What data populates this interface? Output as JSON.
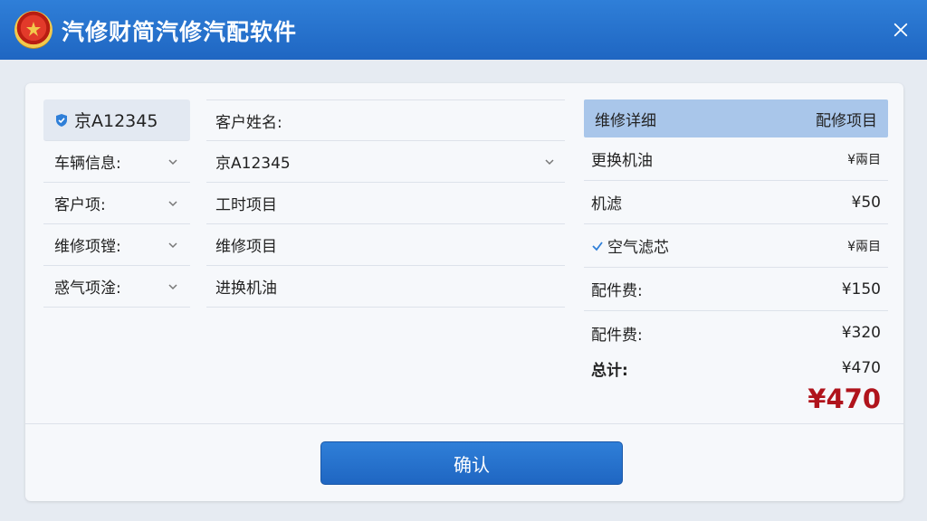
{
  "window": {
    "title": "汽修财简汽修汽配软件",
    "logo_icon": "emblem-icon",
    "close_icon": "close-icon"
  },
  "colors": {
    "titlebar": "#2273cc",
    "header_band": "#a9c6ea",
    "total_red": "#b0141c",
    "button": "#2273cc"
  },
  "left_fields": {
    "plate": "京A12345",
    "plate_icon": "shield-icon",
    "items": [
      {
        "label": "车辆信息:"
      },
      {
        "label": "客户项:"
      },
      {
        "label": "维修项镗:"
      },
      {
        "label": "惑气项淦:"
      }
    ]
  },
  "mid_fields": {
    "customer_name_label": "客户姓名:",
    "plate_select_value": "京A12345",
    "labor_item": "工时项目",
    "repair_item": "维修项目",
    "oil_item": "进换机油"
  },
  "detail": {
    "header_left": "维修详细",
    "header_right": "配修项目",
    "rows": [
      {
        "name": "更换机油",
        "price": "¥兩目"
      },
      {
        "name": "机滤",
        "price": "¥50"
      },
      {
        "name": "空气滤芯",
        "price": "¥兩目"
      },
      {
        "name": "配件费:",
        "price": "¥150"
      },
      {
        "name": "配件费:",
        "price": "¥320"
      }
    ],
    "total_label": "总计:",
    "total_amount": "¥470",
    "grand_total": "¥470"
  },
  "actions": {
    "confirm_label": "确认"
  }
}
